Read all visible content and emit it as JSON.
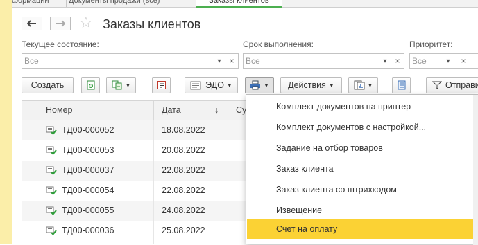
{
  "tabs": [
    {
      "label": "формации"
    },
    {
      "label": "Документы продажи (все)"
    },
    {
      "label": "Заказы клиентов"
    }
  ],
  "header": {
    "title": "Заказы клиентов",
    "back_icon": "arrow-left-icon",
    "forward_icon": "arrow-right-icon",
    "favorite_icon": "star-icon"
  },
  "filters": {
    "state": {
      "label": "Текущее состояние:",
      "value": "Все"
    },
    "deadline": {
      "label": "Срок выполнения:",
      "value": "Все"
    },
    "priority": {
      "label": "Приоритет:",
      "value": "Все"
    }
  },
  "toolbar": {
    "create": "Создать",
    "edo": "ЭДО",
    "actions": "Действия",
    "send": "Отправи"
  },
  "table": {
    "columns": [
      "Номер",
      "Дата",
      "Су"
    ],
    "sort_indicator": "↓",
    "rows": [
      {
        "number": "ТД00-000052",
        "date": "18.08.2022"
      },
      {
        "number": "ТД00-000053",
        "date": "20.08.2022"
      },
      {
        "number": "ТД00-000037",
        "date": "22.08.2022"
      },
      {
        "number": "ТД00-000054",
        "date": "22.08.2022"
      },
      {
        "number": "ТД00-000055",
        "date": "24.08.2022"
      },
      {
        "number": "ТД00-000036",
        "date": "25.08.2022"
      }
    ]
  },
  "print_menu": {
    "items": [
      "Комплект документов на принтер",
      "Комплект документов с настройкой...",
      "Задание на отбор товаров",
      "Заказ клиента",
      "Заказ клиента со штрихкодом",
      "Извещение",
      "Счет на оплату"
    ],
    "highlighted": "Счет на оплату"
  },
  "colors": {
    "highlight": "#fbd234",
    "sidebar": "#fbeea9",
    "tab_accent": "#4caf50"
  }
}
